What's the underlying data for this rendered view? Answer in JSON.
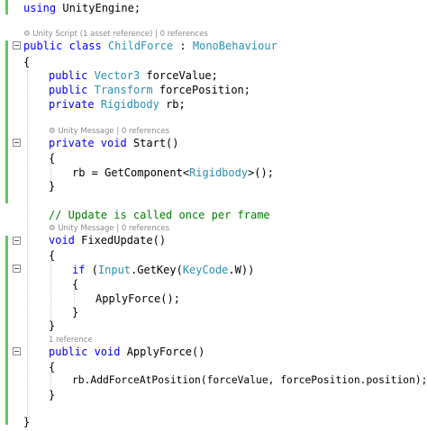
{
  "code": {
    "using": {
      "kw": "using",
      "rest": " UnityEngine;"
    },
    "lens_class": "⚙ Unity Script (1 asset reference) | 0 references",
    "class_decl": {
      "kw": "public class",
      "sp1": " ",
      "name": "ChildForce",
      "sep": " : ",
      "base": "MonoBehaviour"
    },
    "open_class": "{",
    "field1": {
      "kw": "public",
      "sp": " ",
      "type": "Vector3",
      "rest": " forceValue;"
    },
    "field2": {
      "kw": "public",
      "sp": " ",
      "type": "Transform",
      "rest": " forcePosition;"
    },
    "field3": {
      "kw": "private",
      "sp": " ",
      "type": "Rigidbody",
      "rest": " rb;"
    },
    "lens_start": "⚙ Unity Message | 0 references",
    "start_decl": {
      "kw": "private void",
      "rest": " Start()"
    },
    "start_open": "{",
    "start_body": {
      "pre": "rb = GetComponent<",
      "type": "Rigidbody",
      "post": ">();"
    },
    "start_close": "}",
    "comment": "// Update is called once per frame",
    "lens_fixed": "⚙ Unity Message | 0 references",
    "fixed_decl": {
      "kw": "void",
      "rest": " FixedUpdate()"
    },
    "fixed_open": "{",
    "if_line": {
      "kw": "if",
      "p1": " (",
      "type1": "Input",
      "p2": ".GetKey(",
      "type2": "KeyCode",
      "p3": ".W))"
    },
    "if_open": "{",
    "apply_call": "ApplyForce();",
    "if_close": "}",
    "fixed_close": "}",
    "lens_apply": "1 reference",
    "apply_decl": {
      "kw": "public void",
      "rest": " ApplyForce()"
    },
    "apply_open": "{",
    "apply_body": "rb.AddForceAtPosition(forceValue, forcePosition.position);",
    "apply_close": "}",
    "close_class": "}"
  }
}
